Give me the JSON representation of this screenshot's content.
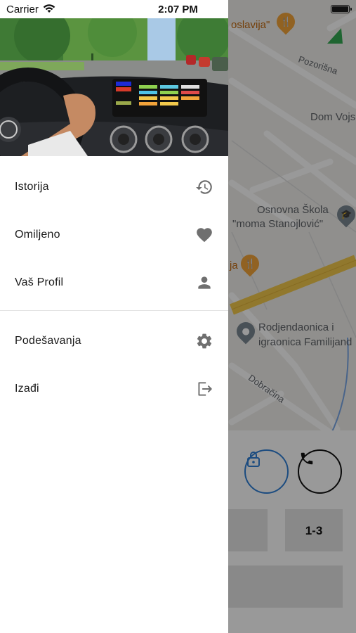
{
  "status_bar": {
    "carrier": "Carrier",
    "time": "2:07 PM"
  },
  "map": {
    "labels": {
      "restaurant_top": "oslavija\"",
      "street_pozorisna": "Pozorišna",
      "place_dom": "Dom Vojs",
      "school_line1": "Osnovna Škola",
      "school_line2": "\"moma Stanojlović\"",
      "restaurant_mid": "ja",
      "party_line1": "Rodjendaonica i",
      "party_line2": "igraonica Familijand",
      "street_dobracina": "Dobračina"
    }
  },
  "booking": {
    "seat_label": "1-3"
  },
  "drawer": {
    "menu": [
      {
        "label": "Istorija",
        "icon": "history-icon"
      },
      {
        "label": "Omiljeno",
        "icon": "heart-icon"
      },
      {
        "label": "Vaš Profil",
        "icon": "person-icon"
      }
    ],
    "menu_secondary": [
      {
        "label": "Podešavanja",
        "icon": "gear-icon"
      },
      {
        "label": "Izađi",
        "icon": "logout-icon"
      }
    ]
  },
  "colors": {
    "accent_blue": "#2f7fd6",
    "icon_grey": "#6f6f6f",
    "map_road_yellow": "#f2c94c",
    "pin_orange": "#f2a33a",
    "overlay": "rgba(0,0,0,0.40)"
  }
}
